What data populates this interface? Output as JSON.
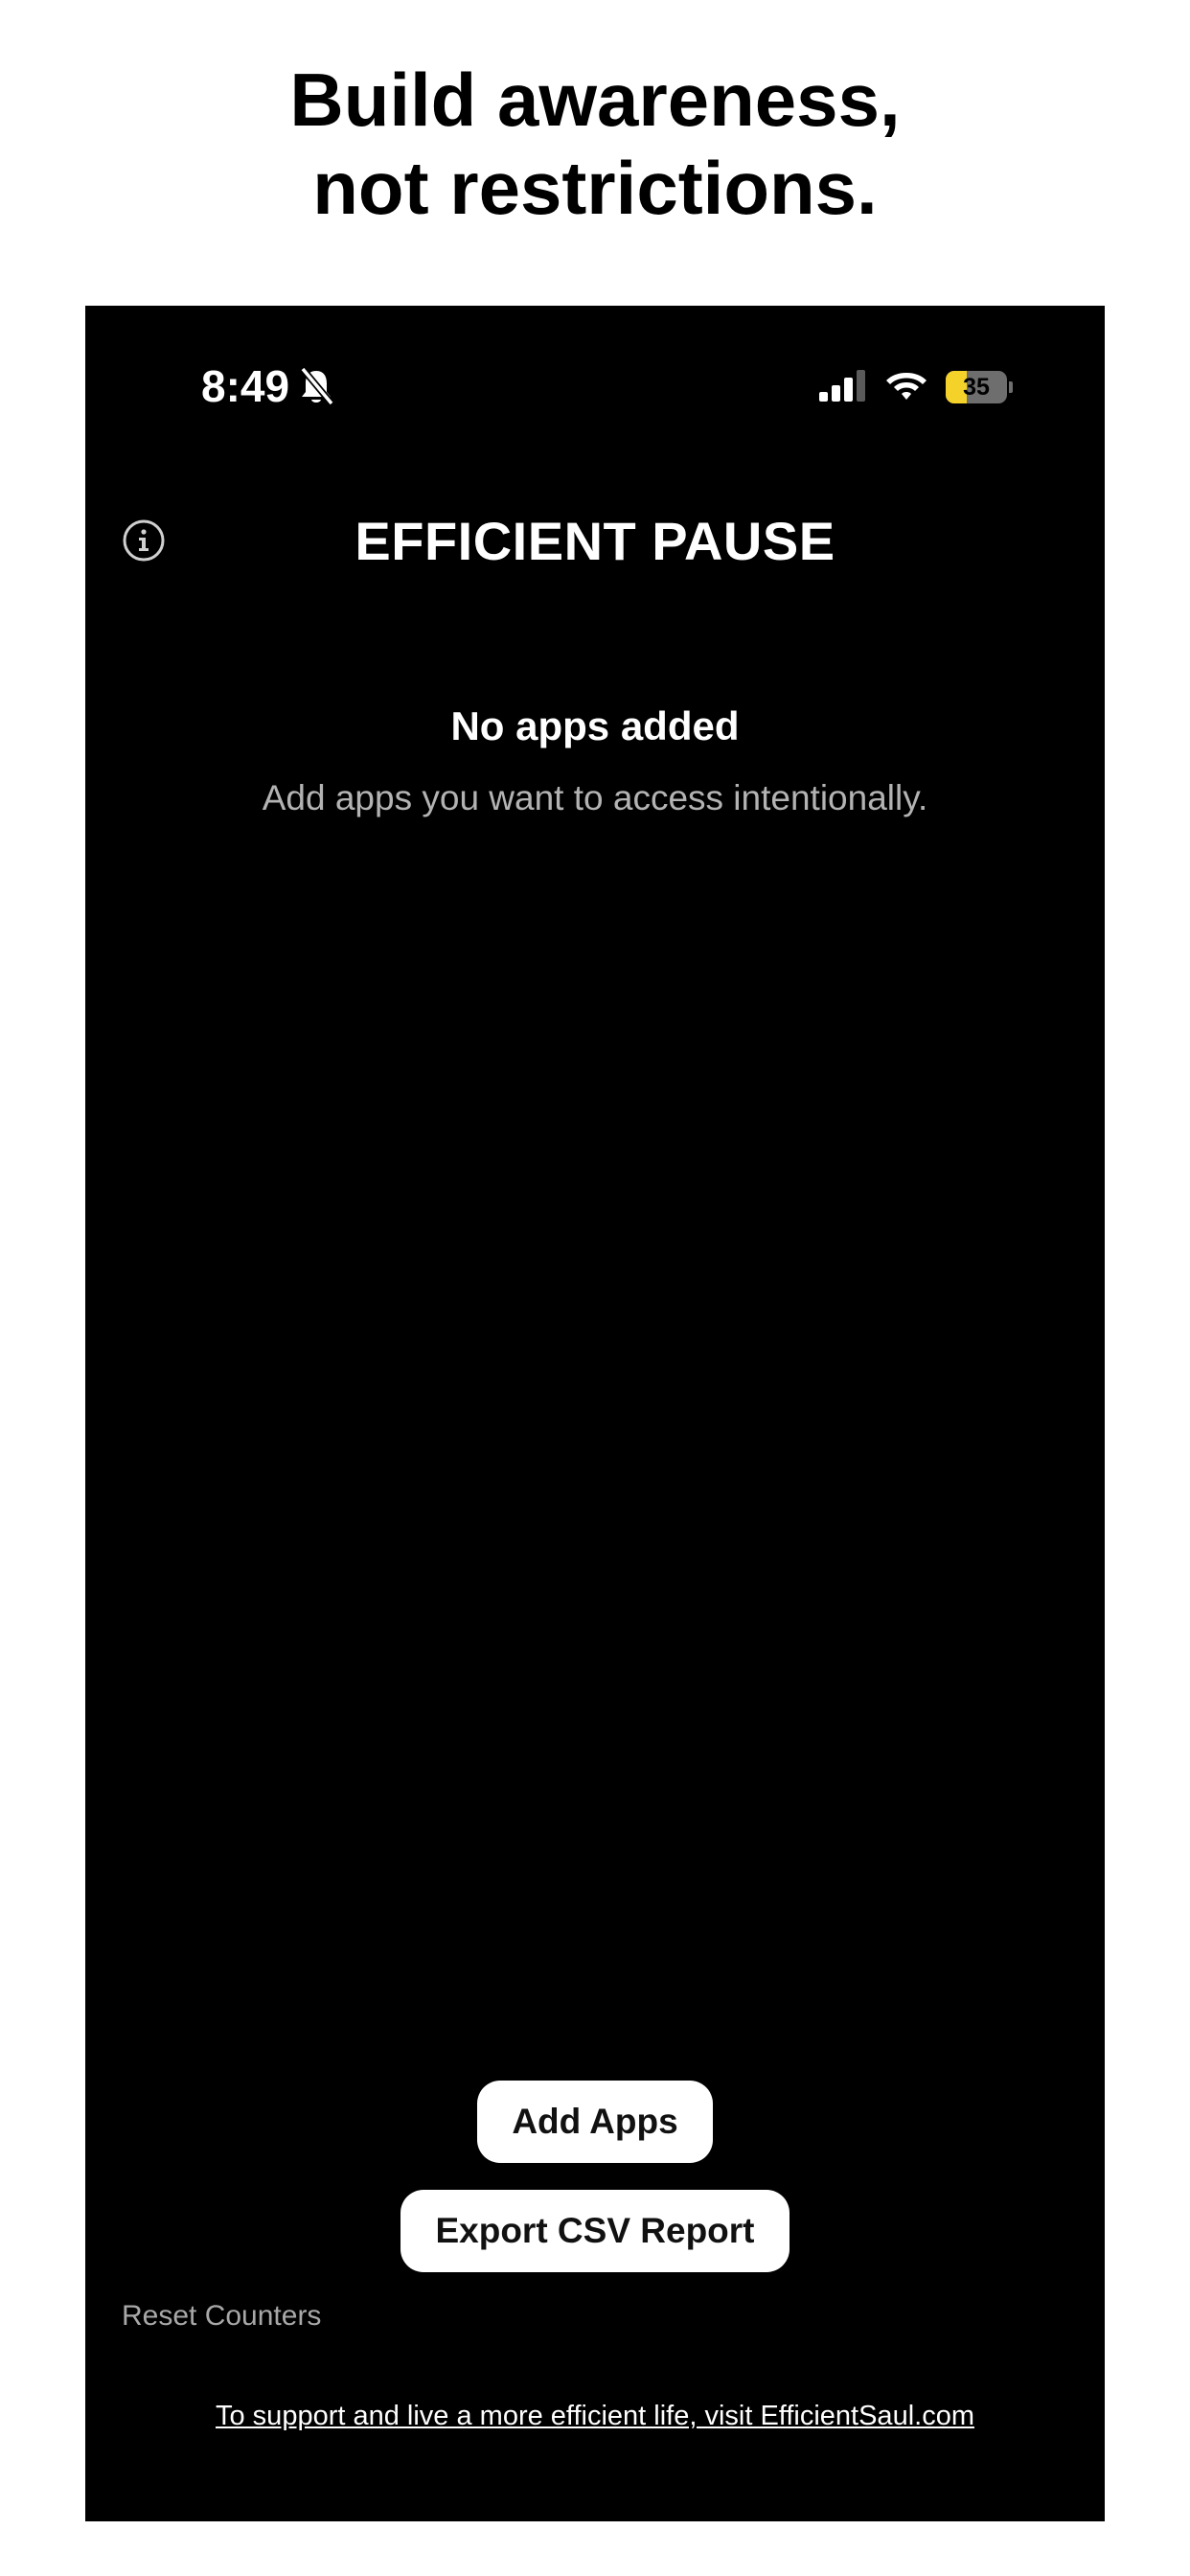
{
  "headline": {
    "line1": "Build awareness,",
    "line2": "not restrictions."
  },
  "status_bar": {
    "time": "8:49",
    "battery_level": "35",
    "battery_fraction": 0.35,
    "battery_color": "#f5d22a",
    "icons": [
      "bell-slash-icon",
      "signal-icon",
      "wifi-icon",
      "battery-charging-icon"
    ]
  },
  "nav": {
    "title": "EFFICIENT PAUSE",
    "info_icon": "info-icon"
  },
  "empty_state": {
    "title": "No apps added",
    "subtitle": "Add apps you want to access intentionally."
  },
  "actions": {
    "add_apps_label": "Add Apps",
    "export_label": "Export CSV Report",
    "reset_label": "Reset Counters"
  },
  "footer": {
    "link_text": "To support and live a more efficient life, visit EfficientSaul.com"
  },
  "colors": {
    "screen_background": "#000000",
    "button_background": "#ffffff",
    "secondary_text": "#b3b3b3"
  }
}
